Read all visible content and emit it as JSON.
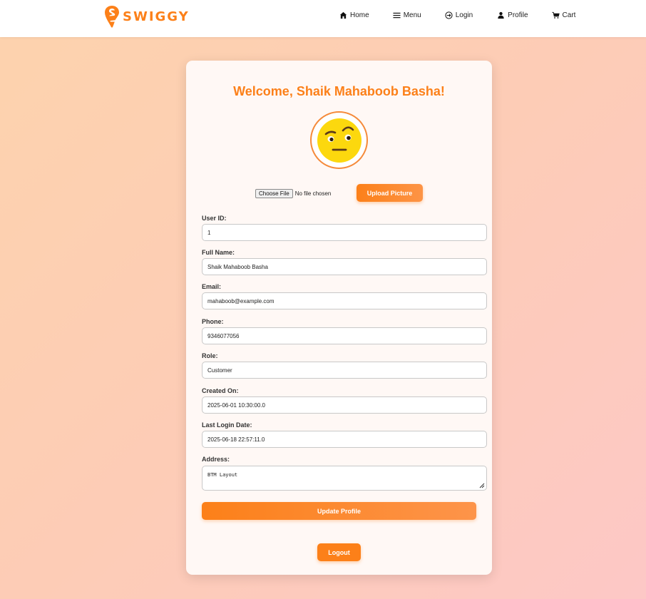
{
  "header": {
    "brand": "SWIGGY",
    "brand_color": "#fc8019",
    "nav": [
      {
        "label": "Home",
        "icon": "home-icon"
      },
      {
        "label": "Menu",
        "icon": "menu-icon"
      },
      {
        "label": "Login",
        "icon": "login-icon"
      },
      {
        "label": "Profile",
        "icon": "user-icon"
      },
      {
        "label": "Cart",
        "icon": "cart-icon"
      }
    ]
  },
  "profile": {
    "welcome": "Welcome, Shaik Mahaboob Basha!",
    "avatar_icon": "raised-eyebrow-emoji",
    "file_button": "Choose File",
    "file_status": "No file chosen",
    "upload_label": "Upload Picture",
    "fields": {
      "user_id": {
        "label": "User ID:",
        "value": "1"
      },
      "full_name": {
        "label": "Full Name:",
        "value": "Shaik Mahaboob Basha"
      },
      "email": {
        "label": "Email:",
        "value": "mahaboob@example.com"
      },
      "phone": {
        "label": "Phone:",
        "value": "9346077056"
      },
      "role": {
        "label": "Role:",
        "value": "Customer"
      },
      "created_on": {
        "label": "Created On:",
        "value": "2025-06-01 10:30:00.0"
      },
      "last_login": {
        "label": "Last Login Date:",
        "value": "2025-06-18 22:57:11.0"
      },
      "address": {
        "label": "Address:",
        "value": "BTM Layout"
      }
    },
    "update_label": "Update Profile",
    "logout_label": "Logout"
  }
}
